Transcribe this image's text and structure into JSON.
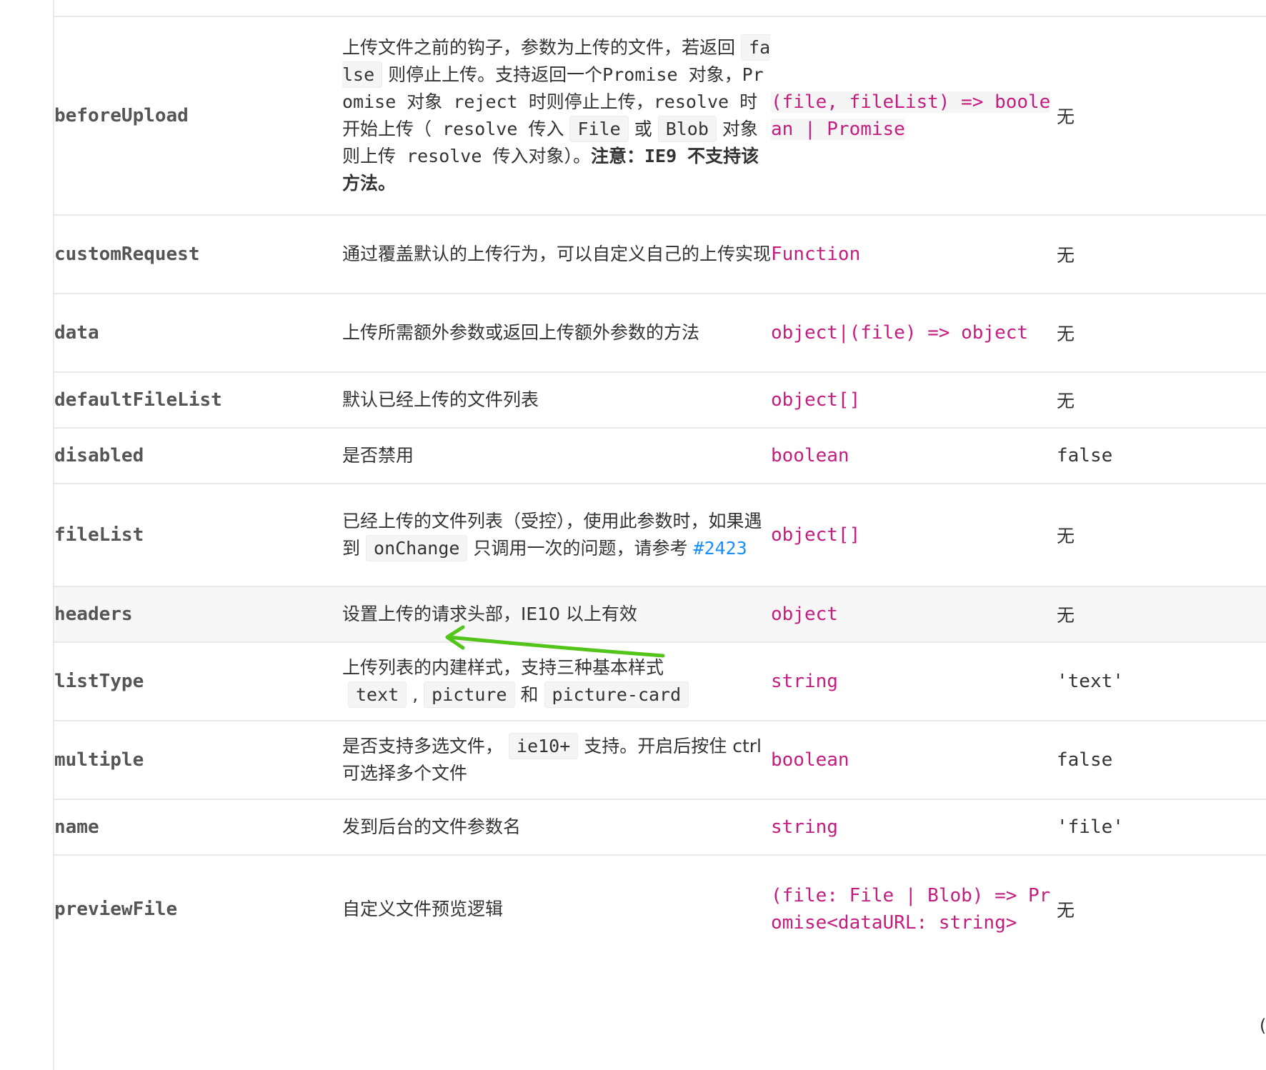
{
  "rows": [
    {
      "name": "beforeUpload",
      "desc": {
        "t1": "上传文件之前的钩子，参数为上传的文件，若返回",
        "c1": "false",
        "t2": "则停止上传。支持返回一个",
        "t3": "Promise 对象，Promise 对象 reject 时则停止上传，resolve 时开始上传（ resolve 传入",
        "c2": "File",
        "t4": "或",
        "c3": "Blob",
        "t5": "对象则上传 resolve 传入对象）。",
        "b1": "注意：IE9 不支持该方法。"
      },
      "type": "(file, fileList) => boolean | Promise",
      "default": "无"
    },
    {
      "name": "customRequest",
      "desc": "通过覆盖默认的上传行为，可以自定义自己的上传实现",
      "type": "Function",
      "default": "无"
    },
    {
      "name": "data",
      "desc": "上传所需额外参数或返回上传额外参数的方法",
      "type": "object|(file) => object",
      "default": "无"
    },
    {
      "name": "defaultFileList",
      "desc": "默认已经上传的文件列表",
      "type": "object[]",
      "default": "无"
    },
    {
      "name": "disabled",
      "desc": "是否禁用",
      "type": "boolean",
      "default": "false"
    },
    {
      "name": "fileList",
      "desc": {
        "t1": "已经上传的文件列表（受控），使用此参数时，如果遇到",
        "c1": "onChange",
        "t2": "只调用一次的问题，请参考",
        "link": "#2423"
      },
      "type": "object[]",
      "default": "无"
    },
    {
      "name": "headers",
      "desc": "设置上传的请求头部，IE10 以上有效",
      "type": "object",
      "default": "无"
    },
    {
      "name": "listType",
      "desc": {
        "t1": "上传列表的内建样式，支持三种基本样式",
        "c1": "text",
        "sep1": ",",
        "c2": "picture",
        "t2": "和",
        "c3": "picture-card"
      },
      "type": "string",
      "default": "'text'"
    },
    {
      "name": "multiple",
      "desc": {
        "t1": "是否支持多选文件，",
        "c1": "ie10+",
        "t2": "支持。开启后按住 ctrl 可选择多个文件"
      },
      "type": "boolean",
      "default": "false"
    },
    {
      "name": "name",
      "desc": "发到后台的文件参数名",
      "type": "string",
      "default": "'file'"
    },
    {
      "name": "previewFile",
      "desc": "自定义文件预览逻辑",
      "type": "(file: File | Blob) => Promise<dataURL: string>",
      "default": "无"
    }
  ],
  "edge_fragment": "(",
  "colors": {
    "type": "#c41d7f",
    "link": "#1890ff",
    "arrow": "#52c41a",
    "row_highlight": "#f7f7f7"
  },
  "annotation": {
    "kind": "arrow",
    "color": "#52c41a",
    "points_to": "#2423"
  }
}
